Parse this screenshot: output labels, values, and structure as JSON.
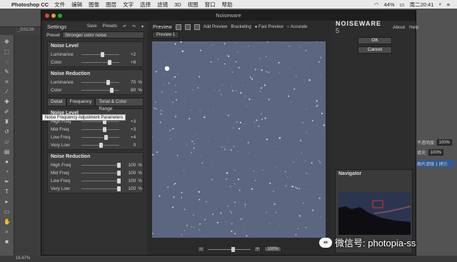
{
  "macbar": {
    "app": "Photoshop CC",
    "menus": [
      "文件",
      "编辑",
      "图像",
      "图层",
      "文字",
      "选择",
      "滤镜",
      "3D",
      "视图",
      "窗口",
      "帮助"
    ],
    "status": [
      "44%",
      "周二20:41"
    ]
  },
  "ps": {
    "doc_tab": "_DSC36",
    "bottom_status": "16.67%",
    "right_panel": {
      "opacity_label": "不透明度:",
      "opacity": "100%",
      "fill_label": "填充:",
      "fill": "100%",
      "layer_name": "图片滤镜 1 拷贝"
    }
  },
  "noiseware": {
    "title": "Noiseware",
    "settings": {
      "title": "Settings",
      "save": "Save",
      "presets": "Presets",
      "preset_label": "Preset",
      "preset_value": "Stronger color noise",
      "noise_level": {
        "title": "Noise Level",
        "rows": [
          {
            "label": "Luminance",
            "value": "+2",
            "unit": "",
            "level": 0.55
          },
          {
            "label": "Color",
            "value": "+8",
            "unit": "",
            "level": 0.75
          }
        ]
      },
      "noise_reduction": {
        "title": "Noise Reduction",
        "rows": [
          {
            "label": "Luminance",
            "value": "70",
            "unit": "%",
            "level": 0.7
          },
          {
            "label": "Color",
            "value": "80",
            "unit": "%",
            "level": 0.8
          }
        ]
      },
      "tabs": [
        "Detail",
        "Frequency",
        "Tonal & Color Range"
      ],
      "tooltip": "Noise Frequency Adjustment Parameters",
      "freq_level": {
        "title": "Noise Level",
        "rows": [
          {
            "label": "High Freq",
            "value": "+3",
            "unit": "",
            "level": 0.6
          },
          {
            "label": "Mid Freq",
            "value": "+3",
            "unit": "",
            "level": 0.6
          },
          {
            "label": "Low Freq",
            "value": "+4",
            "unit": "",
            "level": 0.65
          },
          {
            "label": "Very Low",
            "value": "0",
            "unit": "",
            "level": 0.5
          }
        ]
      },
      "freq_reduction": {
        "title": "Noise Reduction",
        "rows": [
          {
            "label": "High Freq",
            "value": "100",
            "unit": "%",
            "level": 1
          },
          {
            "label": "Mid Freq",
            "value": "100",
            "unit": "%",
            "level": 1
          },
          {
            "label": "Low Freq",
            "value": "100",
            "unit": "%",
            "level": 1
          },
          {
            "label": "Very Low",
            "value": "100",
            "unit": "%",
            "level": 1
          }
        ]
      }
    },
    "preview": {
      "title": "Preview",
      "add_preview": "Add Preview",
      "bracketing": "Bracketing",
      "fast_preview": "Fast Preview",
      "accurate": "Accurate",
      "tab": "Preview 1",
      "zoom": "100%"
    },
    "side": {
      "logo": "NOISEWARE",
      "version": "5",
      "about": "About",
      "help": "Help",
      "ok": "OK",
      "cancel": "Cancel",
      "navigator": "Navigator"
    }
  },
  "watermark": "微信号: photopia-ss",
  "colors": {
    "accent": "#5d6a80"
  }
}
